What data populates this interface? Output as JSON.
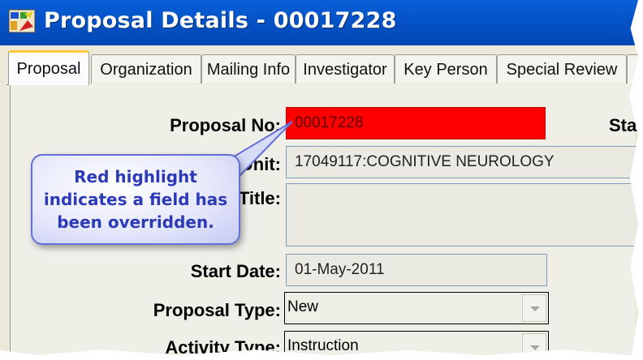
{
  "window": {
    "title": "Proposal Details - 00017228"
  },
  "tabs": [
    {
      "label": "Proposal"
    },
    {
      "label": "Organization"
    },
    {
      "label": "Mailing Info"
    },
    {
      "label": "Investigator"
    },
    {
      "label": "Key Person"
    },
    {
      "label": "Special Review"
    }
  ],
  "form": {
    "proposal_no_label": "Proposal No:",
    "proposal_no_value": "00017228",
    "status_label_partial": "Sta",
    "lead_unit_label_partial": "d Unit:",
    "lead_unit_value": "17049117:COGNITIVE NEUROLOGY",
    "title_label": "Title:",
    "title_value": "",
    "start_date_label": "Start Date:",
    "start_date_value": "01-May-2011",
    "proposal_type_label": "Proposal Type:",
    "proposal_type_value": "New",
    "activity_type_label": "Activity Type:",
    "activity_type_value": "Instruction"
  },
  "callout": {
    "line1": "Red highlight",
    "line2": "indicates a field has",
    "line3": "been overridden."
  },
  "colors": {
    "override_highlight": "#ff0000",
    "titlebar": "#0453c7",
    "callout_text": "#2c3ab8"
  }
}
